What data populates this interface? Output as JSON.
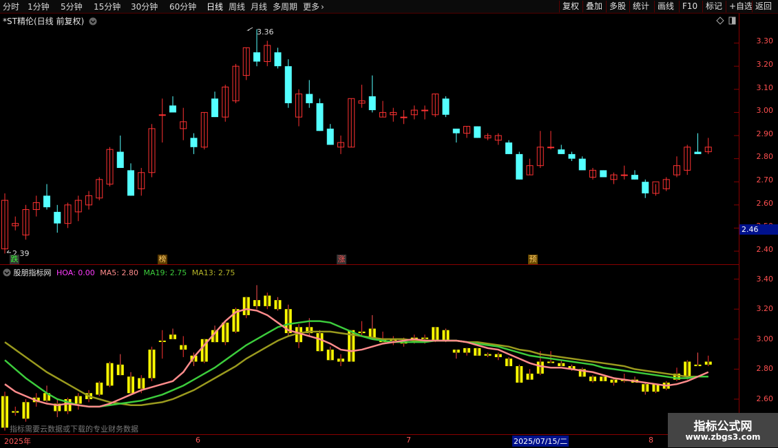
{
  "toolbar": {
    "periods": [
      "分时",
      "1分钟",
      "5分钟",
      "15分钟",
      "30分钟",
      "60分钟",
      "日线",
      "周线",
      "月线",
      "多周期",
      "更多"
    ],
    "active_period": "日线",
    "more_arrow": "›",
    "right_buttons": [
      "复权",
      "叠加",
      "多股",
      "统计",
      "画线",
      "F10",
      "标记",
      "+自选",
      "返回"
    ]
  },
  "main_chart": {
    "title": "*ST精伦(日线 前复权)",
    "y_ticks": [
      "3.30",
      "3.20",
      "3.10",
      "3.00",
      "2.90",
      "2.80",
      "2.70",
      "2.60",
      "2.50",
      "2.40"
    ],
    "high_label": "3.36",
    "low_label": "2.39",
    "current_price": "2.46",
    "event_markers": [
      "跌",
      "榜",
      "涨",
      "预"
    ]
  },
  "indicator": {
    "name": "股朋指标网",
    "hoa": "HOA: 0.00",
    "ma5": "MA5: 2.80",
    "ma19": "MA19: 2.75",
    "ma13": "MA13: 2.75",
    "y_ticks": [
      "3.40",
      "3.20",
      "3.00",
      "2.80",
      "2.60"
    ],
    "note": "指标需要云数据或下载的专业财务数据"
  },
  "date_axis": {
    "labels": [
      "2025年",
      "6",
      "7",
      "2025/07/15/二",
      "8"
    ]
  },
  "watermark": {
    "title": "指标公式网",
    "url": "www.zbgs3.com"
  },
  "colors": {
    "up": "#ff3232",
    "down": "#54ffff",
    "ma5": "#ff8c8c",
    "ma19": "#3ccc3c",
    "ma13": "#9a9a1e",
    "hoa": "#ff3cff",
    "yellow": "#ffff00"
  },
  "chart_data": {
    "type": "candlestick",
    "ohlc": [
      [
        2.41,
        2.65,
        2.39,
        2.62
      ],
      [
        2.51,
        2.55,
        2.49,
        2.52
      ],
      [
        2.47,
        2.6,
        2.45,
        2.58
      ],
      [
        2.58,
        2.64,
        2.55,
        2.61
      ],
      [
        2.64,
        2.69,
        2.58,
        2.59
      ],
      [
        2.57,
        2.6,
        2.48,
        2.52
      ],
      [
        2.52,
        2.61,
        2.5,
        2.6
      ],
      [
        2.57,
        2.64,
        2.53,
        2.62
      ],
      [
        2.6,
        2.66,
        2.58,
        2.64
      ],
      [
        2.63,
        2.72,
        2.62,
        2.71
      ],
      [
        2.69,
        2.85,
        2.68,
        2.84
      ],
      [
        2.83,
        2.9,
        2.76,
        2.76
      ],
      [
        2.75,
        2.78,
        2.64,
        2.64
      ],
      [
        2.67,
        2.76,
        2.64,
        2.74
      ],
      [
        2.74,
        2.95,
        2.72,
        2.93
      ],
      [
        2.99,
        3.06,
        2.87,
        2.99
      ],
      [
        3.03,
        3.07,
        3.01,
        3.0
      ],
      [
        2.93,
        3.02,
        2.88,
        2.96
      ],
      [
        2.89,
        2.91,
        2.82,
        2.85
      ],
      [
        2.85,
        3.0,
        2.84,
        3.0
      ],
      [
        3.06,
        3.09,
        2.98,
        2.98
      ],
      [
        2.98,
        3.12,
        2.96,
        3.11
      ],
      [
        3.05,
        3.21,
        3.04,
        3.2
      ],
      [
        3.16,
        3.28,
        3.14,
        3.28
      ],
      [
        3.26,
        3.36,
        3.2,
        3.22
      ],
      [
        3.22,
        3.31,
        3.2,
        3.29
      ],
      [
        3.26,
        3.28,
        3.19,
        3.2
      ],
      [
        3.2,
        3.23,
        3.02,
        3.04
      ],
      [
        2.98,
        3.1,
        2.94,
        3.08
      ],
      [
        3.08,
        3.14,
        3.02,
        3.04
      ],
      [
        3.04,
        3.06,
        2.92,
        2.92
      ],
      [
        2.93,
        2.95,
        2.86,
        2.86
      ],
      [
        2.85,
        2.9,
        2.82,
        2.87
      ],
      [
        2.85,
        3.06,
        2.85,
        3.06
      ],
      [
        3.04,
        3.12,
        3.02,
        3.05
      ],
      [
        3.07,
        3.16,
        3.0,
        3.01
      ],
      [
        2.98,
        3.05,
        2.98,
        3.0
      ],
      [
        2.99,
        3.02,
        2.96,
        3.0
      ],
      [
        2.98,
        3.01,
        2.95,
        2.98
      ],
      [
        2.99,
        3.03,
        2.97,
        3.01
      ],
      [
        3.01,
        3.03,
        2.97,
        3.01
      ],
      [
        2.99,
        3.08,
        2.98,
        3.08
      ],
      [
        3.06,
        3.07,
        2.98,
        2.99
      ],
      [
        2.93,
        2.92,
        2.87,
        2.91
      ],
      [
        2.91,
        2.94,
        2.89,
        2.94
      ],
      [
        2.94,
        2.94,
        2.89,
        2.89
      ],
      [
        2.89,
        2.91,
        2.88,
        2.9
      ],
      [
        2.88,
        2.91,
        2.86,
        2.9
      ],
      [
        2.87,
        2.88,
        2.82,
        2.82
      ],
      [
        2.82,
        2.83,
        2.71,
        2.71
      ],
      [
        2.73,
        2.8,
        2.73,
        2.77
      ],
      [
        2.77,
        2.92,
        2.76,
        2.85
      ],
      [
        2.85,
        2.92,
        2.84,
        2.85
      ],
      [
        2.84,
        2.86,
        2.82,
        2.82
      ],
      [
        2.82,
        2.83,
        2.79,
        2.8
      ],
      [
        2.8,
        2.81,
        2.76,
        2.75
      ],
      [
        2.72,
        2.76,
        2.71,
        2.75
      ],
      [
        2.75,
        2.75,
        2.72,
        2.72
      ],
      [
        2.71,
        2.74,
        2.69,
        2.73
      ],
      [
        2.73,
        2.77,
        2.71,
        2.73
      ],
      [
        2.73,
        2.75,
        2.71,
        2.71
      ],
      [
        2.7,
        2.71,
        2.63,
        2.65
      ],
      [
        2.65,
        2.69,
        2.64,
        2.7
      ],
      [
        2.67,
        2.72,
        2.66,
        2.71
      ],
      [
        2.73,
        2.81,
        2.72,
        2.77
      ],
      [
        2.75,
        2.86,
        2.73,
        2.85
      ],
      [
        2.83,
        2.91,
        2.82,
        2.82
      ],
      [
        2.83,
        2.89,
        2.82,
        2.85
      ]
    ],
    "ma5": [
      2.7,
      2.65,
      2.62,
      2.59,
      2.57,
      2.56,
      2.57,
      2.56,
      2.55,
      2.55,
      2.57,
      2.6,
      2.63,
      2.66,
      2.68,
      2.7,
      2.72,
      2.78,
      2.88,
      2.96,
      3.04,
      3.12,
      3.18,
      3.2,
      3.19,
      3.16,
      3.11,
      3.06,
      3.04,
      3.02,
      3.0,
      2.97,
      2.93,
      2.92,
      2.93,
      2.95,
      2.97,
      2.98,
      2.99,
      3.0,
      2.99,
      2.99,
      2.99,
      2.99,
      2.98,
      2.96,
      2.94,
      2.93,
      2.9,
      2.87,
      2.84,
      2.82,
      2.81,
      2.81,
      2.8,
      2.79,
      2.78,
      2.76,
      2.74,
      2.73,
      2.72,
      2.71,
      2.7,
      2.69,
      2.7,
      2.72,
      2.75,
      2.78
    ],
    "ma19": [
      2.86,
      2.8,
      2.74,
      2.69,
      2.64,
      2.6,
      2.58,
      2.56,
      2.55,
      2.55,
      2.56,
      2.57,
      2.58,
      2.59,
      2.61,
      2.63,
      2.66,
      2.69,
      2.73,
      2.77,
      2.81,
      2.86,
      2.91,
      2.96,
      3.0,
      3.04,
      3.08,
      3.1,
      3.11,
      3.12,
      3.12,
      3.11,
      3.08,
      3.05,
      3.02,
      3.0,
      2.99,
      2.98,
      2.98,
      2.98,
      2.98,
      2.99,
      2.99,
      2.99,
      2.98,
      2.97,
      2.96,
      2.95,
      2.93,
      2.91,
      2.89,
      2.88,
      2.87,
      2.86,
      2.85,
      2.84,
      2.83,
      2.81,
      2.8,
      2.79,
      2.78,
      2.77,
      2.76,
      2.75,
      2.74,
      2.74,
      2.75,
      2.75
    ],
    "ma13": [
      2.98,
      2.93,
      2.88,
      2.83,
      2.78,
      2.74,
      2.7,
      2.66,
      2.62,
      2.6,
      2.58,
      2.57,
      2.56,
      2.56,
      2.57,
      2.58,
      2.6,
      2.63,
      2.66,
      2.7,
      2.74,
      2.78,
      2.82,
      2.87,
      2.91,
      2.95,
      2.99,
      3.02,
      3.04,
      3.05,
      3.05,
      3.05,
      3.04,
      3.03,
      3.02,
      3.01,
      3.0,
      3.0,
      3.0,
      2.99,
      2.99,
      2.99,
      2.99,
      2.99,
      2.98,
      2.98,
      2.97,
      2.96,
      2.95,
      2.93,
      2.92,
      2.9,
      2.89,
      2.88,
      2.87,
      2.86,
      2.85,
      2.84,
      2.83,
      2.82,
      2.8,
      2.79,
      2.78,
      2.77,
      2.76,
      2.75,
      2.75,
      2.75
    ]
  }
}
